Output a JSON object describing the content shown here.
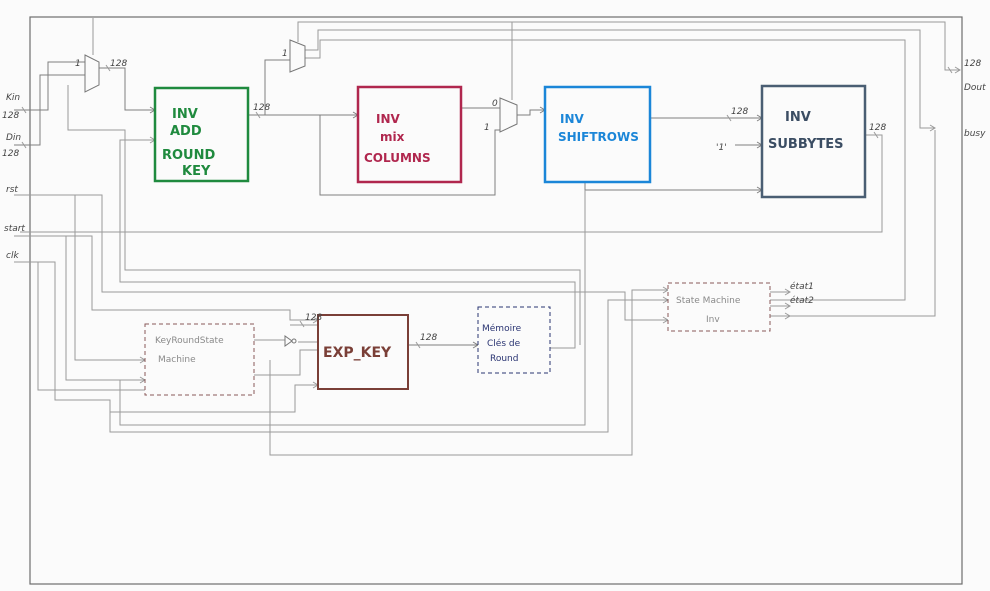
{
  "blocks": {
    "inv_add_round_key": [
      "INV",
      "ADD",
      "ROUND",
      "KEY"
    ],
    "inv_mix_columns": [
      "INV",
      "mix",
      "COLUMNS"
    ],
    "inv_shiftrows": [
      "INV",
      "SHIFTROWS"
    ],
    "inv_subbytes": [
      "INV",
      "SUBBYTES"
    ],
    "exp_key": "EXP_KEY",
    "key_round_sm": [
      "KeyRoundState",
      "Machine"
    ],
    "memoire": [
      "Mémoire",
      "Clés de",
      "Round"
    ],
    "state_machine_inv": [
      "State Machine",
      "Inv"
    ]
  },
  "ports": {
    "kin": "Kin",
    "kin_width": "128",
    "din": "Din",
    "din_width": "128",
    "rst": "rst",
    "start": "start",
    "clk": "clk",
    "dout": "Dout",
    "dout_width": "128",
    "busy": "busy"
  },
  "signals": {
    "etat1": "état1",
    "etat2": "état2",
    "one": "'1'"
  },
  "labels": {
    "w128": "128",
    "sel0": "0",
    "sel1": "1"
  },
  "colors": {
    "add_round_key": "#1f8a3e",
    "mix_columns": "#b0274e",
    "shiftrows": "#1b86d8",
    "subbytes": "#4a5e73",
    "exp_key": "#7a3f37",
    "memoire": "#2a3472"
  }
}
